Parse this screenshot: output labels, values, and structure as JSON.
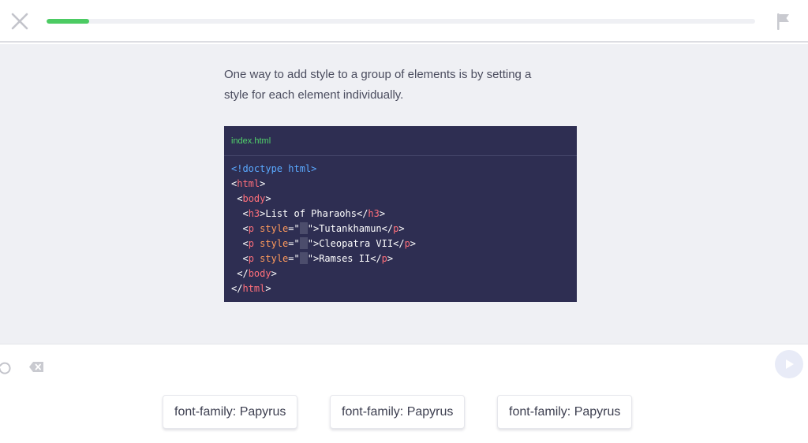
{
  "header": {
    "progress_percent": 6,
    "close_icon": "close-x-icon",
    "flag_icon": "flag-icon"
  },
  "lesson": {
    "prompt_line1": "One way to add style to a group of elements is by setting a",
    "prompt_line2": "style for each element individually."
  },
  "code": {
    "filename": "index.html",
    "lines": {
      "doctype": "<!doctype html>",
      "html_open_lt": "<",
      "html_open_tag": "html",
      "html_open_gt": ">",
      "body_open_lt": "<",
      "body_open_tag": "body",
      "body_open_gt": ">",
      "h3_lt": "<",
      "h3_tag": "h3",
      "h3_gt": ">",
      "h3_text": "List of Pharaohs",
      "h3_close_lt": "</",
      "h3_close_tag": "h3",
      "h3_close_gt": ">",
      "p_lt": "<",
      "p_tag": "p",
      "p_attr": "style",
      "p_eq_quote": "=\"",
      "p_quote_close": "\">",
      "p1_text": "Tutankhamun",
      "p2_text": "Cleopatra VII",
      "p3_text": "Ramses II",
      "p_close_lt": "</",
      "p_close_tag": "p",
      "p_close_gt": ">",
      "body_close_lt": "</",
      "body_close_tag": "body",
      "body_close_gt": ">",
      "html_close_lt": "</",
      "html_close_tag": "html",
      "html_close_gt": ">"
    }
  },
  "controls": {
    "undo_icon": "undo-icon",
    "backspace_icon": "backspace-icon",
    "run_icon": "play-icon"
  },
  "options": [
    "font-family: Papyrus",
    "font-family: Papyrus",
    "font-family: Papyrus"
  ],
  "colors": {
    "progress": "#4ccb63",
    "code_bg": "#2e2e52",
    "filename": "#51d36b",
    "tag": "#ff6f7a",
    "attr": "#ff9a5c",
    "doctype": "#5aa9ff"
  }
}
